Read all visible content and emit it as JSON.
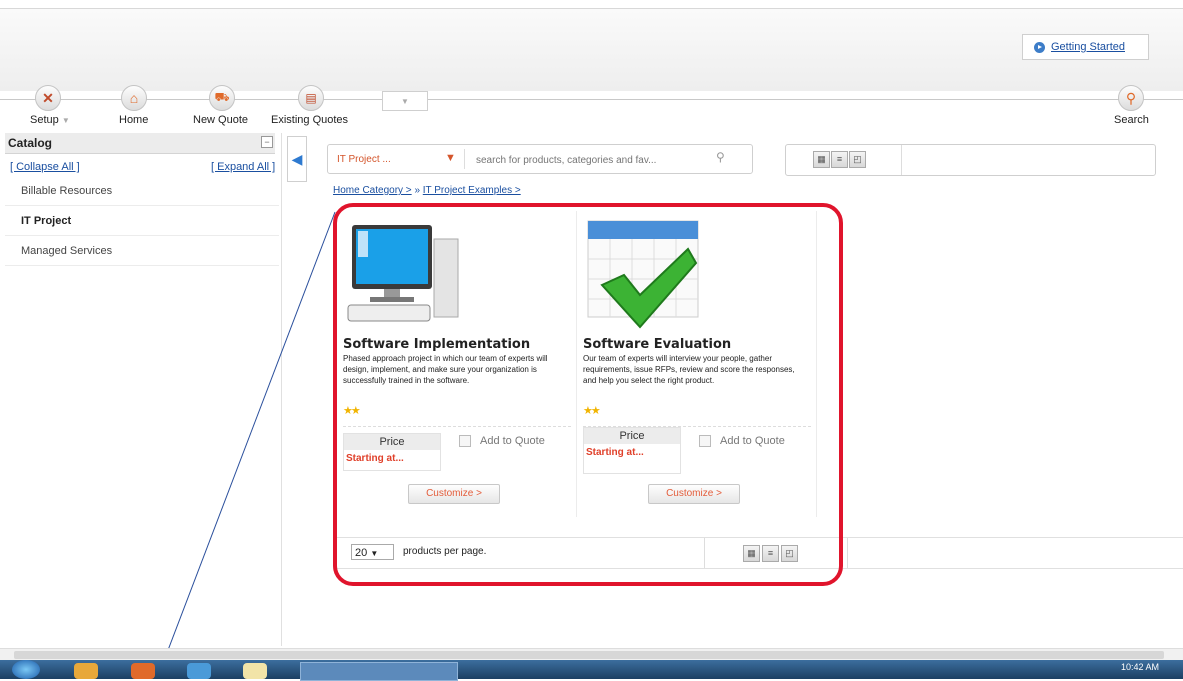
{
  "header": {
    "getting_started": "Getting Started"
  },
  "toolbar": {
    "items": [
      {
        "label": "Setup",
        "icon": "wrench-icon"
      },
      {
        "label": "Home",
        "icon": "home-icon"
      },
      {
        "label": "New Quote",
        "icon": "cart-icon"
      },
      {
        "label": "Existing Quotes",
        "icon": "quotes-icon"
      },
      {
        "label": "Search",
        "icon": "search-icon"
      }
    ],
    "dropdown_arrow": "▼"
  },
  "sidebar": {
    "title": "Catalog",
    "collapse_all": "[ Collapse All ]",
    "expand_all": "[ Expand All ]",
    "items": [
      {
        "label": "Billable Resources"
      },
      {
        "label": "IT Project"
      },
      {
        "label": "Managed Services"
      }
    ]
  },
  "search": {
    "category": "IT Project ...",
    "placeholder": "search for products, categories and fav..."
  },
  "breadcrumb": {
    "home": "Home Category >",
    "sep": "»",
    "current": "IT Project Examples >"
  },
  "products": [
    {
      "title": "Software Implementation",
      "description": "Phased approach project in which our team of experts will design, implement, and make sure your organization is successfully trained in the software.",
      "price_label": "Price",
      "price_value": "Starting at...",
      "add_to_quote": "Add to Quote",
      "customize": "Customize >"
    },
    {
      "title": "Software Evaluation",
      "description": "Our team of experts will interview your people, gather requirements, issue RFPs, review and score the responses, and help you select the right product.",
      "price_label": "Price",
      "price_value": "Starting at...",
      "add_to_quote": "Add to Quote",
      "customize": "Customize >"
    }
  ],
  "pager": {
    "per_page_value": "20",
    "per_page_label": "products per page."
  },
  "taskbar": {
    "time": "10:42 AM"
  },
  "colors": {
    "accent": "#d4552b",
    "highlight": "#e0142c",
    "link": "#1a4fa0",
    "price": "#e0402a"
  }
}
